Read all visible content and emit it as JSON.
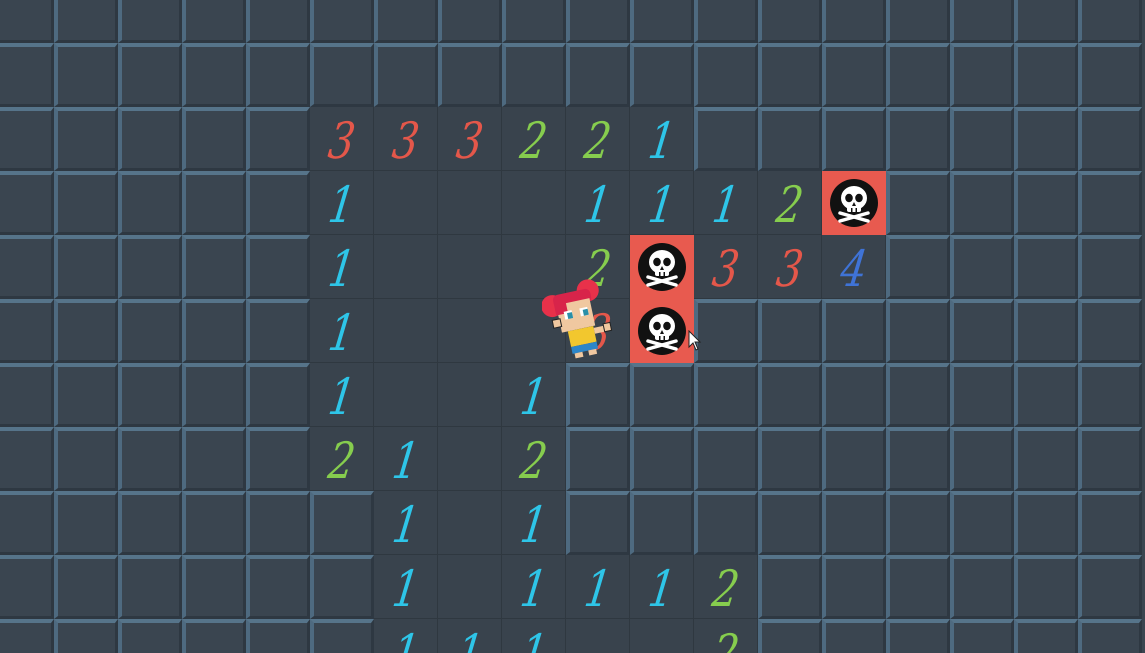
{
  "colors": {
    "closed_tile": "#3a4550",
    "open_tile": "#39434d",
    "mine_tile": "#e85a4f",
    "number_1": "#2ec5e8",
    "number_2": "#86cd4e",
    "number_3": "#e4574a",
    "number_4": "#3f73d6"
  },
  "grid": {
    "cols": 18,
    "rows": 11,
    "cells": [
      "CCCCCCCCCCCCCCCCCC",
      "CCCCCCCCCCCCCCCCCC",
      "CCCCC333221CCCCCCC",
      "CCCCC1...1112MCCCC",
      "CCCCC1...2M334CCCC",
      "CCCCC1...3MCCCCCCC",
      "CCCCC1..1CCCCCCCCC",
      "CCCCC21.2CCCCCCCCC",
      "CCCCCC1.1CCCCCCCCC",
      "CCCCCC1.1112CCCCCC",
      "CCCCCC111..2CCCCCC"
    ]
  },
  "icons": {
    "mine": "skull-crossbones-icon",
    "player": "player-character",
    "cursor": "mouse-pointer-icon"
  }
}
